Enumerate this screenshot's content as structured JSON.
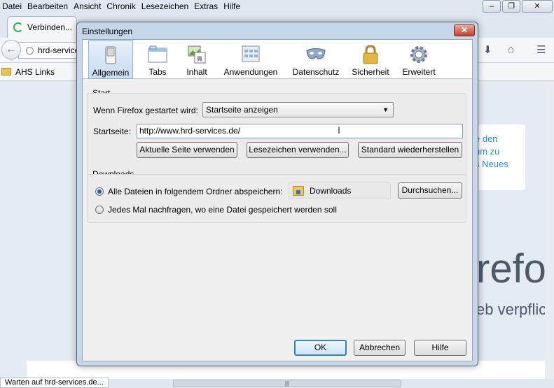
{
  "browser": {
    "menu": [
      "Datei",
      "Bearbeiten",
      "Ansicht",
      "Chronik",
      "Lesezeichen",
      "Extras",
      "Hilfe"
    ],
    "tab_title": "Verbinden...",
    "url": "hrd-service",
    "bookmark_folder": "AHS Links",
    "page_text_card": [
      "e den",
      "um zu",
      "s Neues"
    ],
    "page_text_big": "refo",
    "page_text_sub": "eb verpflic",
    "status_text": "Warten auf hrd-services.de..."
  },
  "dialog": {
    "title": "Einstellungen",
    "close_glyph": "✕",
    "tabs": [
      {
        "label": "Allgemein",
        "icon": "switch-icon"
      },
      {
        "label": "Tabs",
        "icon": "tabs-window-icon"
      },
      {
        "label": "Inhalt",
        "icon": "content-icon"
      },
      {
        "label": "Anwendungen",
        "icon": "applications-icon"
      },
      {
        "label": "Datenschutz",
        "icon": "mask-icon"
      },
      {
        "label": "Sicherheit",
        "icon": "padlock-icon"
      },
      {
        "label": "Erweitert",
        "icon": "gear-icon"
      }
    ],
    "selected_tab": "Allgemein",
    "start": {
      "group_title": "Start",
      "when_label": "Wenn Firefox gestartet wird:",
      "when_value": "Startseite anzeigen",
      "homepage_label": "Startseite:",
      "homepage_value": "http://www.hrd-services.de/",
      "btn_current": "Aktuelle Seite verwenden",
      "btn_bookmark": "Lesezeichen verwenden...",
      "btn_restore": "Standard wiederherstellen"
    },
    "downloads": {
      "group_title": "Downloads",
      "option_save": "Alle Dateien in folgendem Ordner abspeichern:",
      "folder": "Downloads",
      "btn_browse": "Durchsuchen...",
      "option_ask": "Jedes Mal nachfragen, wo eine Datei gespeichert werden soll",
      "selected_option": "save"
    },
    "footer": {
      "ok": "OK",
      "cancel": "Abbrechen",
      "help": "Hilfe"
    }
  }
}
